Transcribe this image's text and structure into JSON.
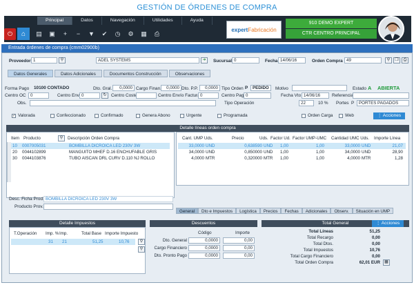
{
  "page_title": "GESTIÓN DE ÓRDENES DE COMPRA",
  "menu": [
    "Principal",
    "Datos",
    "Navegación",
    "Utilidades",
    "Ayuda"
  ],
  "brand": {
    "text1": "expert",
    "text2": "Fabricación"
  },
  "company": {
    "line1": "910 DEMO EXPERT",
    "line2": "CTR CENTRO PRINCIPAL"
  },
  "window_title": "Entrada órdenes de compra (cmm02900b)",
  "header": {
    "proveedor_label": "Proveedor",
    "proveedor_code": "1",
    "proveedor_name": "ADEL SYSTEMS",
    "sucursal_label": "Sucursal",
    "sucursal": "0",
    "fecha_label": "Fecha",
    "fecha": "14/06/16",
    "orden_label": "Orden Compra",
    "orden": "49"
  },
  "section_tabs": [
    "Datos Generales",
    "Datos Adicionales",
    "Documentos Construcción",
    "Observaciones"
  ],
  "general": {
    "forma_pago_label": "Forma Pago",
    "forma_pago": "10100 CONTADO",
    "dto_gral_label": "Dto. Gral.",
    "dto_gral": "0,0000",
    "cargo_finan_label": "Cargo Finan.",
    "cargo_finan": "0,0000",
    "dto_pp_label": "Dto. P.P.",
    "dto_pp": "0,0000",
    "tipo_orden_label": "Tipo Orden",
    "tipo_orden_code": "P",
    "tipo_orden": "PEDIDO",
    "motivo_label": "Motivo",
    "estado_label": "Estado",
    "estado_code": "A",
    "estado": "ABIERTA",
    "centro_oc_label": "Centro OC",
    "centro_oc": "0",
    "centro_envio_label": "Centro Envío",
    "centro_envio": "0",
    "centro_coste_label": "Centro Coste",
    "centro_envio_factura_label": "Centro Envío Factura",
    "centro_envio_factura": "0",
    "centro_pago_label": "Centro Pago",
    "centro_pago": "0",
    "fecha_vto_label": "Fecha Vto",
    "fecha_vto": "14/06/16",
    "referencia_label": "Referencia",
    "obs_label": "Obs.",
    "tipo_operacion_label": "Tipo Operación",
    "tipo_operacion": "22",
    "pct": "10 %",
    "portes_label": "Portes",
    "portes_code": "P",
    "portes": "PORTES PAGADOS"
  },
  "checks": [
    {
      "label": "Valorada",
      "checked": true
    },
    {
      "label": "Confeccionado",
      "checked": false
    },
    {
      "label": "Confirmado",
      "checked": false
    },
    {
      "label": "Genera Abono",
      "checked": false
    },
    {
      "label": "Urgente",
      "checked": false
    },
    {
      "label": "Programada",
      "checked": false
    },
    {
      "label": "Orden Carga",
      "checked": false
    },
    {
      "label": "Web",
      "checked": false
    }
  ],
  "acciones_label": "Acciones",
  "lines": {
    "title": "Detalle líneas orden compra",
    "cols_left": [
      "Item",
      "Producto",
      "Descripción Orden Compra"
    ],
    "cols_right": [
      "Cant. UMP Uds.",
      "Precio",
      "Uds.",
      "Factor Ud.",
      "Factor UMP-UMC",
      "Cantidad UMC Uds.",
      "Importe Línea"
    ],
    "rows": [
      {
        "item": "10",
        "producto": "0007005031",
        "descripcion": "BOMBILLA DICROICA LED 230V 3W",
        "cant": "33,0000",
        "ump": "UND",
        "precio": "0,638590",
        "uds": "UND",
        "factor": "1,00",
        "factor_umc": "1,00",
        "cant_umc": "33,0000",
        "umc": "UND",
        "importe": "21,07"
      },
      {
        "item": "20",
        "producto": "0044102899",
        "descripcion": "MANGUITO MHEF D.16 ENCHUFABLE GRIS",
        "cant": "34,0000",
        "ump": "UND",
        "precio": "0,850000",
        "uds": "UND",
        "factor": "1,00",
        "factor_umc": "1,00",
        "cant_umc": "34,0000",
        "umc": "UND",
        "importe": "28,90"
      },
      {
        "item": "30",
        "producto": "0044103876",
        "descripcion": "TUBO AISCAN DRL CURV D.110 NJ ROLLO",
        "cant": "4,0000",
        "ump": "MTR",
        "precio": "0,320000",
        "uds": "MTR",
        "factor": "1,00",
        "factor_umc": "1,00",
        "cant_umc": "4,0000",
        "umc": "MTR",
        "importe": "1,28"
      }
    ],
    "desc_label": "Desc. Ficha Prod.",
    "desc_value": "BOMBILLA DICROICA LED 230V 3W",
    "producto_prov_label": "Producto Prov."
  },
  "bottom_tabs": [
    "General",
    "Dto e Impuestos",
    "Logística",
    "Precios",
    "Fechas",
    "Adicionales",
    "Observ.",
    "Situación en UMP"
  ],
  "impuestos": {
    "title": "Detalle Impuestos",
    "cols": [
      "T.Operación",
      "Imp. %",
      "Imp.",
      "Total Base",
      "Importe Impuesto"
    ],
    "row": [
      "31",
      "21",
      "51,25",
      "10,76"
    ]
  },
  "descuentos": {
    "title": "Descuentos",
    "cols": [
      "Código",
      "Importe"
    ],
    "rows": [
      {
        "label": "Dto. General",
        "codigo": "0,0000",
        "importe": "0,00"
      },
      {
        "label": "Cargo Financiero",
        "codigo": "0,0000",
        "importe": "0,00"
      },
      {
        "label": "Dto. Pronto Pago",
        "codigo": "0,0000",
        "importe": "0,00"
      }
    ]
  },
  "total": {
    "title": "Total General",
    "acciones": "Acciones",
    "rows": [
      {
        "label": "Total Líneas",
        "value": "51,25"
      },
      {
        "label": "Total Recargo",
        "value": "0,00"
      },
      {
        "label": "Total Dtos.",
        "value": "0,00"
      },
      {
        "label": "Total Impuestos",
        "value": "10,76"
      },
      {
        "label": "Total Cargo Financiero",
        "value": "0,00"
      },
      {
        "label": "Total Orden Compra",
        "value": "62,01 EUR"
      }
    ]
  },
  "colors": {
    "accent": "#2f8ad4",
    "dark": "#1f2a35",
    "green": "#3dab3b",
    "estado": "#1f9a3a"
  }
}
